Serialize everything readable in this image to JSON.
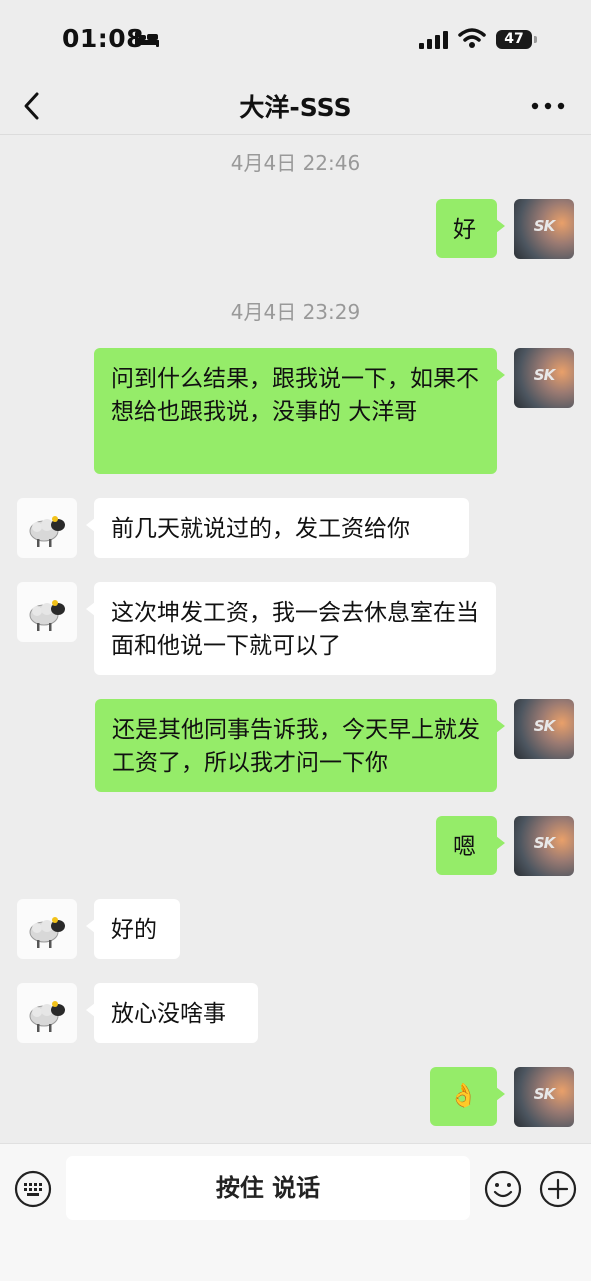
{
  "status": {
    "time": "01:08",
    "battery": "47"
  },
  "header": {
    "title": "大洋-SSS"
  },
  "timestamps": [
    "4月4日 22:46",
    "4月4日 23:29"
  ],
  "messages": [
    {
      "from": "me",
      "text": "好"
    },
    {
      "from": "me",
      "text": "问到什么结果，跟我说一下，如果不想给也跟我说，没事的  大洋哥"
    },
    {
      "from": "them",
      "text": "前几天就说过的，发工资给你"
    },
    {
      "from": "them",
      "text": "这次坤发工资，我一会去休息室在当面和他说一下就可以了"
    },
    {
      "from": "me",
      "text": "还是其他同事告诉我，今天早上就发工资了，所以我才问一下你"
    },
    {
      "from": "me",
      "text": "嗯"
    },
    {
      "from": "them",
      "text": "好的"
    },
    {
      "from": "them",
      "text": "放心没啥事"
    },
    {
      "from": "me",
      "text": "👌"
    }
  ],
  "my_avatar_text": "SK",
  "input": {
    "voice_label": "按住 说话"
  },
  "colors": {
    "my_bubble": "#95ec69",
    "their_bubble": "#ffffff",
    "background": "#ededed"
  }
}
